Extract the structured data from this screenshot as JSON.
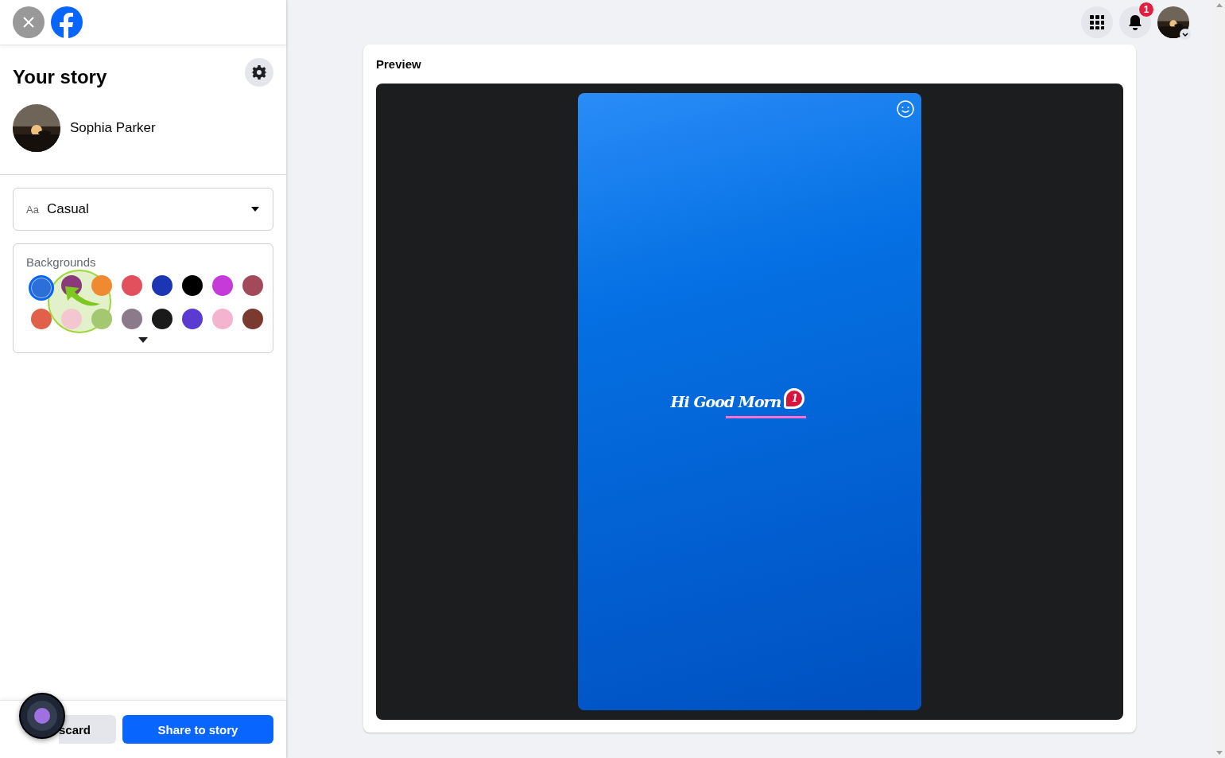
{
  "sidebar": {
    "title": "Your story",
    "user": {
      "name": "Sophia Parker"
    },
    "font_select": {
      "icon_text": "Aa",
      "value": "Casual"
    },
    "backgrounds": {
      "label": "Backgrounds",
      "swatches": [
        {
          "color": "#2d6fd8",
          "selected": true
        },
        {
          "color": "#8a3a7a",
          "selected": false
        },
        {
          "color": "#f08a30",
          "selected": false
        },
        {
          "color": "#e2505e",
          "selected": false
        },
        {
          "color": "#1b35b5",
          "selected": false
        },
        {
          "color": "#000000",
          "selected": false
        },
        {
          "color": "#c53ad8",
          "selected": false
        },
        {
          "color": "#a24a5a",
          "selected": false
        },
        {
          "color": "#e0604a",
          "selected": false
        },
        {
          "color": "#f4c6d0",
          "selected": false
        },
        {
          "color": "#a4c870",
          "selected": false
        },
        {
          "color": "#8a7a8a",
          "selected": false
        },
        {
          "color": "#1a1a1a",
          "selected": false
        },
        {
          "color": "#5a3ad0",
          "selected": false
        },
        {
          "color": "#f4b4d0",
          "selected": false
        },
        {
          "color": "#7a3a30",
          "selected": false
        }
      ]
    },
    "discard_label": "scard",
    "share_label": "Share to story"
  },
  "header": {
    "notification_count": "1"
  },
  "preview": {
    "title": "Preview",
    "story_text": "Hi Good Morn",
    "step_badge": "1"
  }
}
